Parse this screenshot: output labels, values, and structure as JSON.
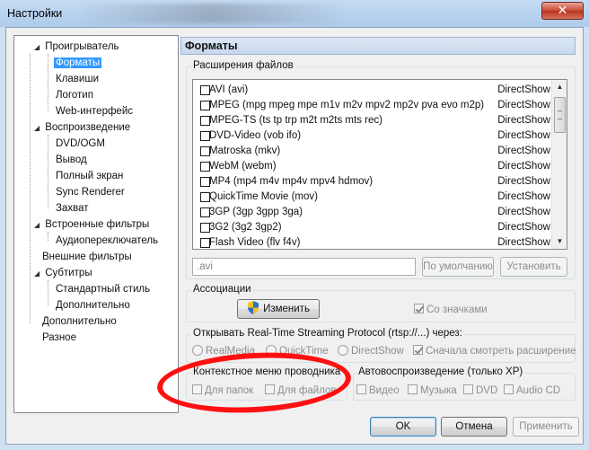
{
  "window": {
    "title": "Настройки",
    "close_glyph": "✕"
  },
  "tree": {
    "items": [
      {
        "label": "Проигрыватель",
        "expanded": true
      },
      {
        "label": "Форматы",
        "selected": true
      },
      {
        "label": "Клавиши"
      },
      {
        "label": "Логотип"
      },
      {
        "label": "Web-интерфейс"
      },
      {
        "label": "Воспроизведение",
        "expanded": true
      },
      {
        "label": "DVD/OGM"
      },
      {
        "label": "Вывод"
      },
      {
        "label": "Полный экран"
      },
      {
        "label": "Sync Renderer"
      },
      {
        "label": "Захват"
      },
      {
        "label": "Встроенные фильтры",
        "expanded": true
      },
      {
        "label": "Аудиопереключатель"
      },
      {
        "label": "Внешние фильтры"
      },
      {
        "label": "Субтитры",
        "expanded": true
      },
      {
        "label": "Стандартный стиль"
      },
      {
        "label": "Дополнительно"
      },
      {
        "label": "Дополнительно"
      },
      {
        "label": "Разное"
      }
    ],
    "expand_glyph": "◢",
    "collapse_glyph": "◢"
  },
  "pane": {
    "title": "Форматы"
  },
  "extensions": {
    "group_label": "Расширения файлов",
    "rows": [
      {
        "name": "AVI (avi)",
        "filter": "DirectShow"
      },
      {
        "name": "MPEG (mpg mpeg mpe m1v m2v mpv2 mp2v pva evo m2p)",
        "filter": "DirectShow"
      },
      {
        "name": "MPEG-TS (ts tp trp m2t m2ts mts rec)",
        "filter": "DirectShow"
      },
      {
        "name": "DVD-Video (vob ifo)",
        "filter": "DirectShow"
      },
      {
        "name": "Matroska (mkv)",
        "filter": "DirectShow"
      },
      {
        "name": "WebM (webm)",
        "filter": "DirectShow"
      },
      {
        "name": "MP4 (mp4 m4v mp4v mpv4 hdmov)",
        "filter": "DirectShow"
      },
      {
        "name": "QuickTime Movie (mov)",
        "filter": "DirectShow"
      },
      {
        "name": "3GP (3gp 3gpp 3ga)",
        "filter": "DirectShow"
      },
      {
        "name": "3G2 (3g2 3gp2)",
        "filter": "DirectShow"
      },
      {
        "name": "Flash Video (flv f4v)",
        "filter": "DirectShow"
      }
    ],
    "ext_value": ".avi",
    "default_button": "По умолчанию",
    "set_button": "Установить"
  },
  "associations": {
    "group_label": "Ассоциации",
    "change_button": "Изменить",
    "with_icons": "Со значками"
  },
  "rtsp": {
    "group_label": "Открывать Real-Time Streaming Protocol (rtsp://...) через:",
    "options": [
      "RealMedia",
      "QuickTime",
      "DirectShow"
    ],
    "check_ext": "Сначала смотреть расширение"
  },
  "context_menu": {
    "group_label": "Контекстное меню проводника",
    "for_folders": "Для папок",
    "for_files": "Для файлов"
  },
  "autoplay": {
    "group_label": "Автовоспроизведение (только XP)",
    "video": "Видео",
    "music": "Музыка",
    "dvd": "DVD",
    "audio_cd": "Audio CD"
  },
  "footer": {
    "ok": "OK",
    "cancel": "Отмена",
    "apply": "Применить"
  },
  "colors": {
    "annotation": "#ff1010",
    "selection": "#3399ff"
  }
}
